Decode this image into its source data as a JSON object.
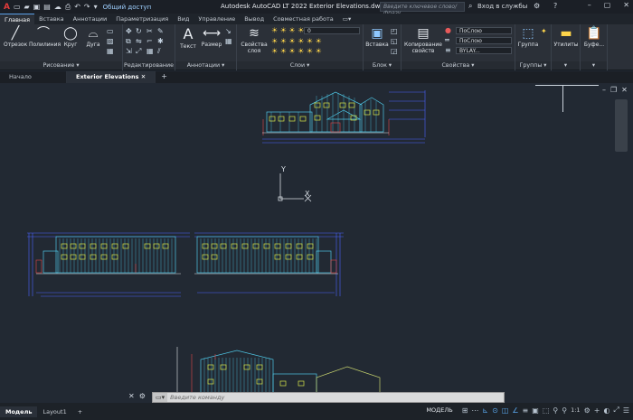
{
  "titlebar": {
    "app_logo": "A",
    "share_label": "Общий доступ",
    "title": "Autodesk AutoCAD LT 2022    Exterior Elevations.dwg",
    "search_placeholder": "Введите ключевое слово/фразу",
    "signin_label": "Вход в службы"
  },
  "ribbon_tabs": [
    "Главная",
    "Вставка",
    "Аннотации",
    "Параметризация",
    "Вид",
    "Управление",
    "Вывод",
    "Совместная работа"
  ],
  "panels": {
    "draw": {
      "label": "Рисование",
      "tools": [
        "Отрезок",
        "Полилиния",
        "Круг",
        "Дуга"
      ]
    },
    "modify": {
      "label": "Редактирование"
    },
    "annotation": {
      "label": "Аннотации",
      "tools": [
        "Текст",
        "Размер"
      ]
    },
    "layers": {
      "label": "Слои",
      "layer_props": "Свойства слоя",
      "layer_value": "0"
    },
    "block": {
      "label": "Блок",
      "insert": "Вставка"
    },
    "properties": {
      "label": "Свойства",
      "match": "Копирование свойств",
      "color": "ПоСлою",
      "linetype": "ПоСлою",
      "lineweight": "BYLAY..."
    },
    "groups": {
      "label": "Группы",
      "group": "Группа"
    },
    "utilities": {
      "label": "Утилиты"
    },
    "clipboard": {
      "label": "Буфе..."
    }
  },
  "doc_tabs": [
    "Начало",
    "Exterior Elevations"
  ],
  "ucs": {
    "x_label": "X",
    "y_label": "Y"
  },
  "command_line": {
    "placeholder": "Введите  команду"
  },
  "layout_tabs": [
    "Модель",
    "Layout1"
  ],
  "status": {
    "model": "МОДЕЛЬ",
    "scale": "1:1"
  },
  "colors": {
    "background": "#222933",
    "building_outline": "#4ec7e6",
    "windows": "#d9e84a",
    "dimensions": "#4a63ff",
    "accents": "#e54848"
  },
  "elevations": [
    {
      "id": "top-elevation"
    },
    {
      "id": "left-elevation"
    },
    {
      "id": "right-elevation"
    },
    {
      "id": "bottom-elevation"
    }
  ]
}
